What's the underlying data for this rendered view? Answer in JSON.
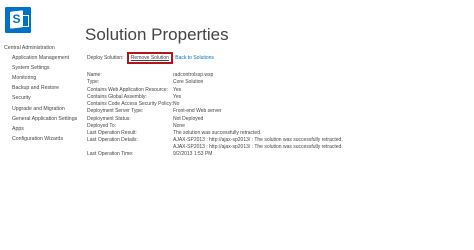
{
  "page": {
    "title": "Solution Properties"
  },
  "quicklaunch": {
    "items": [
      {
        "label": "Central Administration",
        "level": 0
      },
      {
        "label": "Application Management",
        "level": 1
      },
      {
        "label": "System Settings",
        "level": 1
      },
      {
        "label": "Monitoring",
        "level": 1
      },
      {
        "label": "Backup and Restore",
        "level": 1
      },
      {
        "label": "Security",
        "level": 1
      },
      {
        "label": "Upgrade and Migration",
        "level": 1
      },
      {
        "label": "General Application Settings",
        "level": 1
      },
      {
        "label": "Apps",
        "level": 1
      },
      {
        "label": "Configuration Wizards",
        "level": 1
      }
    ]
  },
  "deploy": {
    "label": "Deploy Solution",
    "remove_label": "Remove Solution",
    "back_label": "Back to Solutions"
  },
  "properties": [
    {
      "label": "Name:",
      "value": [
        "radcontrolssp.wsp"
      ]
    },
    {
      "label": "Type:",
      "value": [
        "Core Solution"
      ]
    },
    {
      "label": "Contains Web Application Resource:",
      "value": [
        "Yes"
      ]
    },
    {
      "label": "Contains Global Assembly:",
      "value": [
        "Yes"
      ]
    },
    {
      "label": "Contains Code Access Security Policy:",
      "value": [
        "No"
      ]
    },
    {
      "label": "Deployment Server Type:",
      "value": [
        "Front-end Web server"
      ]
    },
    {
      "label": "Deployment Status:",
      "value": [
        "Not Deployed"
      ]
    },
    {
      "label": "Deployed To:",
      "value": [
        "None"
      ]
    },
    {
      "label": "Last Operation Result:",
      "value": [
        "The solution was successfully retracted."
      ]
    },
    {
      "label": "Last Operation Details:",
      "value": [
        "AJAX-SP2013 : http://ajax-sp2013/ : The solution was successfully retracted.",
        "AJAX-SP2013 : http://ajax-sp2013/ : The solution was successfully retracted."
      ]
    },
    {
      "label": "Last Operation Time:",
      "value": [
        "9/2/2013 1:53 PM"
      ]
    }
  ],
  "colors": {
    "brand": "#0072c6",
    "highlight": "#b2141c",
    "text": "#444444"
  },
  "icons": {
    "logo": "sharepoint-logo-icon"
  }
}
